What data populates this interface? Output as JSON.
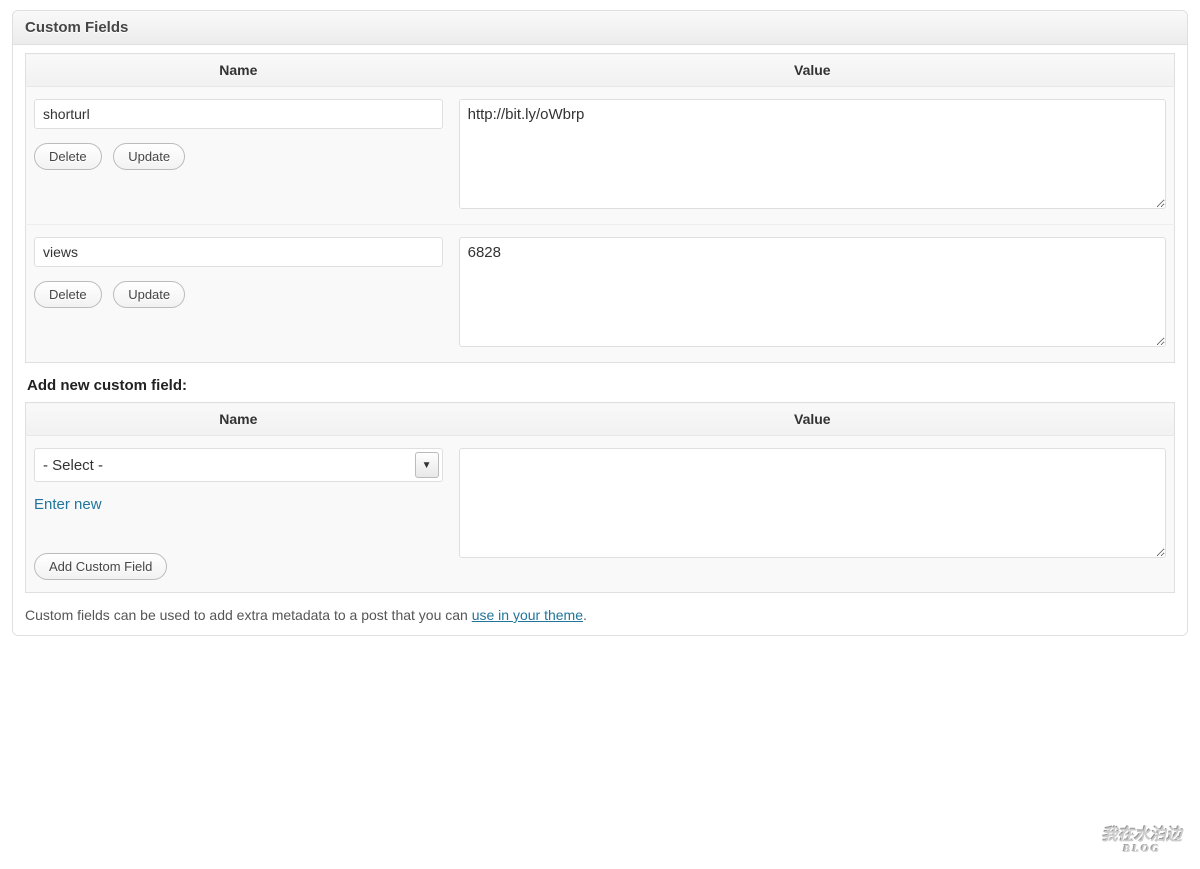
{
  "panel": {
    "title": "Custom Fields",
    "table_headers": {
      "name": "Name",
      "value": "Value"
    },
    "fields": [
      {
        "name": "shorturl",
        "value": "http://bit.ly/oWbrp"
      },
      {
        "name": "views",
        "value": "6828"
      }
    ],
    "buttons": {
      "delete": "Delete",
      "update": "Update",
      "add": "Add Custom Field"
    },
    "add_heading": "Add new custom field:",
    "select_placeholder": "- Select -",
    "enter_new": "Enter new",
    "footer_pre": "Custom fields can be used to add extra metadata to a post that you can ",
    "footer_link": "use in your theme",
    "footer_post": "."
  },
  "watermark": {
    "line1": "我在水泊边",
    "line2": "BLOG"
  }
}
